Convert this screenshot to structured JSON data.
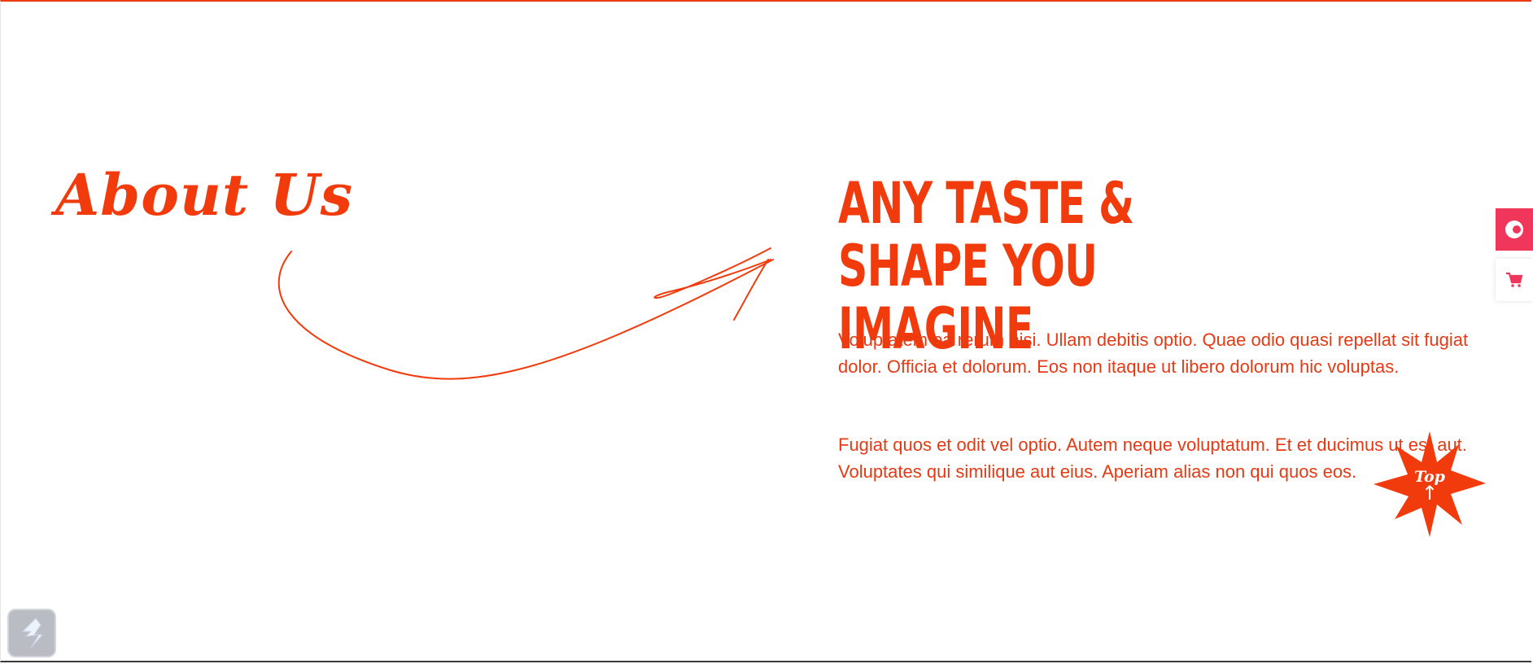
{
  "about": {
    "title": "About Us"
  },
  "content": {
    "headline": "Any Taste & Shape You Imagine",
    "paragraph_1": "Voluptatem ea rerum nisi. Ullam debitis optio. Quae odio quasi repellat sit fugiat dolor. Officia et dolorum. Eos non itaque ut libero dolorum hic voluptas.",
    "paragraph_2": "Fugiat quos et odit vel optio. Autem neque voluptatum. Et et ducimus ut est aut. Voluptates qui similique aut eius. Aperiam alias non qui quos eos."
  },
  "top_button": {
    "label": "Top",
    "arrow": "↑",
    "icon": "starburst-icon"
  },
  "side_tools": {
    "chat_icon": "chat-bubble-icon",
    "cart_icon": "cart-icon"
  },
  "corner_widget": {
    "icon": "lightning-logo-icon"
  },
  "colors": {
    "accent": "#f23b0c",
    "text": "#e63a14",
    "chat_button": "#f0365b",
    "cart_icon": "#f0365b",
    "widget_bg": "#b9bcc3"
  }
}
